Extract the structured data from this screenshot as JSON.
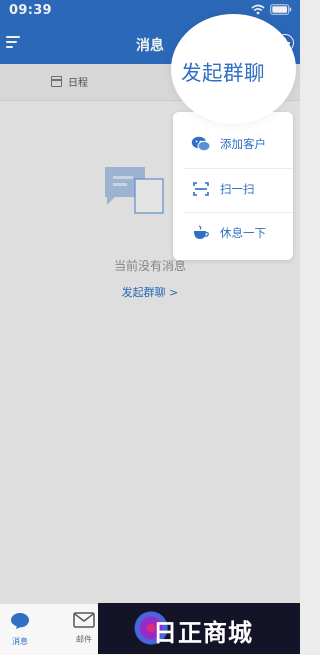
{
  "status_bar": {
    "time": "09:39"
  },
  "header": {
    "title": "消息"
  },
  "tabs": {
    "schedule_label": "日程"
  },
  "empty_state": {
    "message": "当前没有消息",
    "action_label": "发起群聊 >"
  },
  "popup_menu": {
    "magnified_label": "发起群聊",
    "items": [
      {
        "label": "添加客户",
        "icon": "wechat-icon"
      },
      {
        "label": "扫一扫",
        "icon": "scan-icon"
      },
      {
        "label": "休息一下",
        "icon": "coffee-cup-icon"
      }
    ]
  },
  "bottom_nav": {
    "items": [
      {
        "label": "消息",
        "icon": "chat-bubble-icon",
        "active": true
      },
      {
        "label": "邮件",
        "icon": "mail-icon",
        "active": false
      }
    ]
  },
  "watermark": {
    "text": "日正商城"
  },
  "colors": {
    "primary": "#2f6fc4",
    "background": "#ececec",
    "popup_bg": "#ffffff"
  }
}
